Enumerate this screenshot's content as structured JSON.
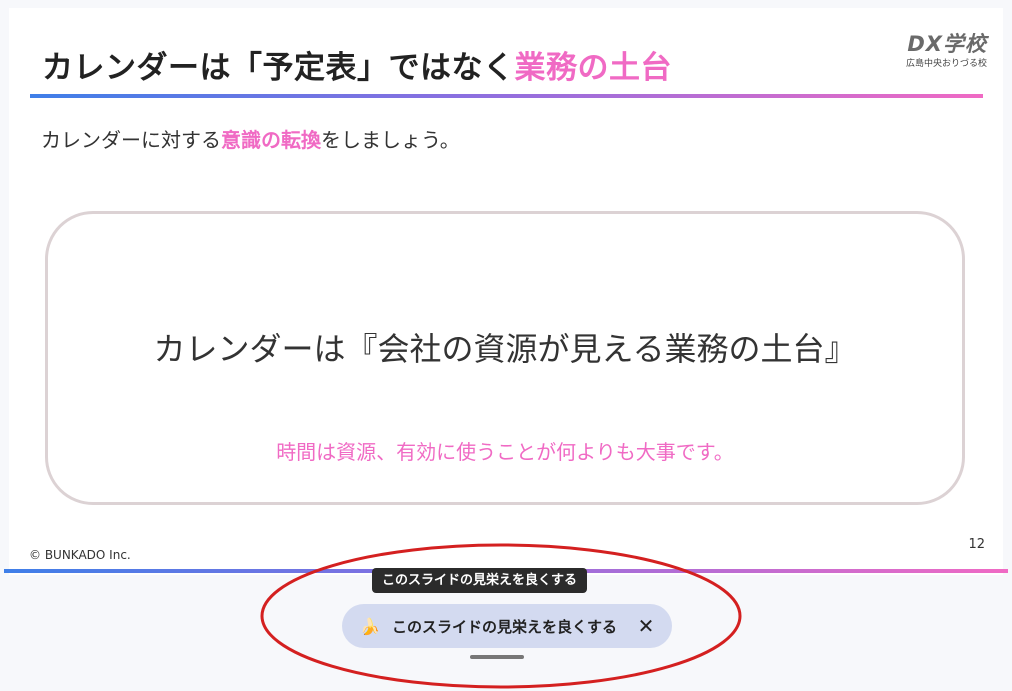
{
  "slide": {
    "title_prefix": "カレンダーは「予定表」ではなく",
    "title_highlight": "業務の土台",
    "logo_main": "DX学校",
    "logo_sub": "広島中央おりづる校",
    "lead_prefix": "カレンダーに対する",
    "lead_highlight": "意識の転換",
    "lead_suffix": "をしましょう。",
    "card_main": "カレンダーは『会社の資源が見える業務の土台』",
    "card_sub": "時間は資源、有効に使うことが何よりも大事です。",
    "copyright": "© BUNKADO Inc.",
    "page_number": "12"
  },
  "toolbar": {
    "tooltip": "このスライドの見栄えを良くする",
    "pill_label": "このスライドの見栄えを良くする",
    "pill_icon": "banana-icon",
    "close_icon": "close-icon"
  },
  "colors": {
    "accent_pink": "#f06ac4",
    "accent_blue": "#3f7fe8",
    "annotation_red": "#d42020"
  }
}
